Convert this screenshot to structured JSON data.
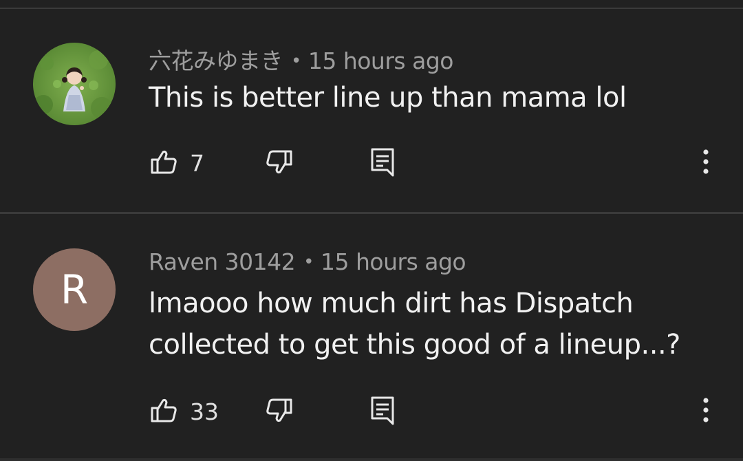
{
  "comments": [
    {
      "author": "六花みゆまき",
      "separator": "•",
      "time": "15 hours ago",
      "text": "This is better line up than mama lol",
      "likes": "7",
      "avatar": {
        "type": "photo"
      }
    },
    {
      "author": "Raven 30142",
      "separator": "•",
      "time": "15 hours ago",
      "text": "lmaooo how much dirt has Dispatch collected to get this good of a lineup...?",
      "likes": "33",
      "avatar": {
        "type": "letter",
        "letter": "R",
        "color": "#8d6e63"
      }
    }
  ],
  "icons": {
    "like": "thumbs-up-icon",
    "dislike": "thumbs-down-icon",
    "reply": "reply-comment-icon",
    "more": "more-vertical-icon"
  },
  "colors": {
    "background": "#212121",
    "divider": "#3a3a3a",
    "meta_text": "#9e9e9e",
    "body_text": "#f1f1f1"
  }
}
